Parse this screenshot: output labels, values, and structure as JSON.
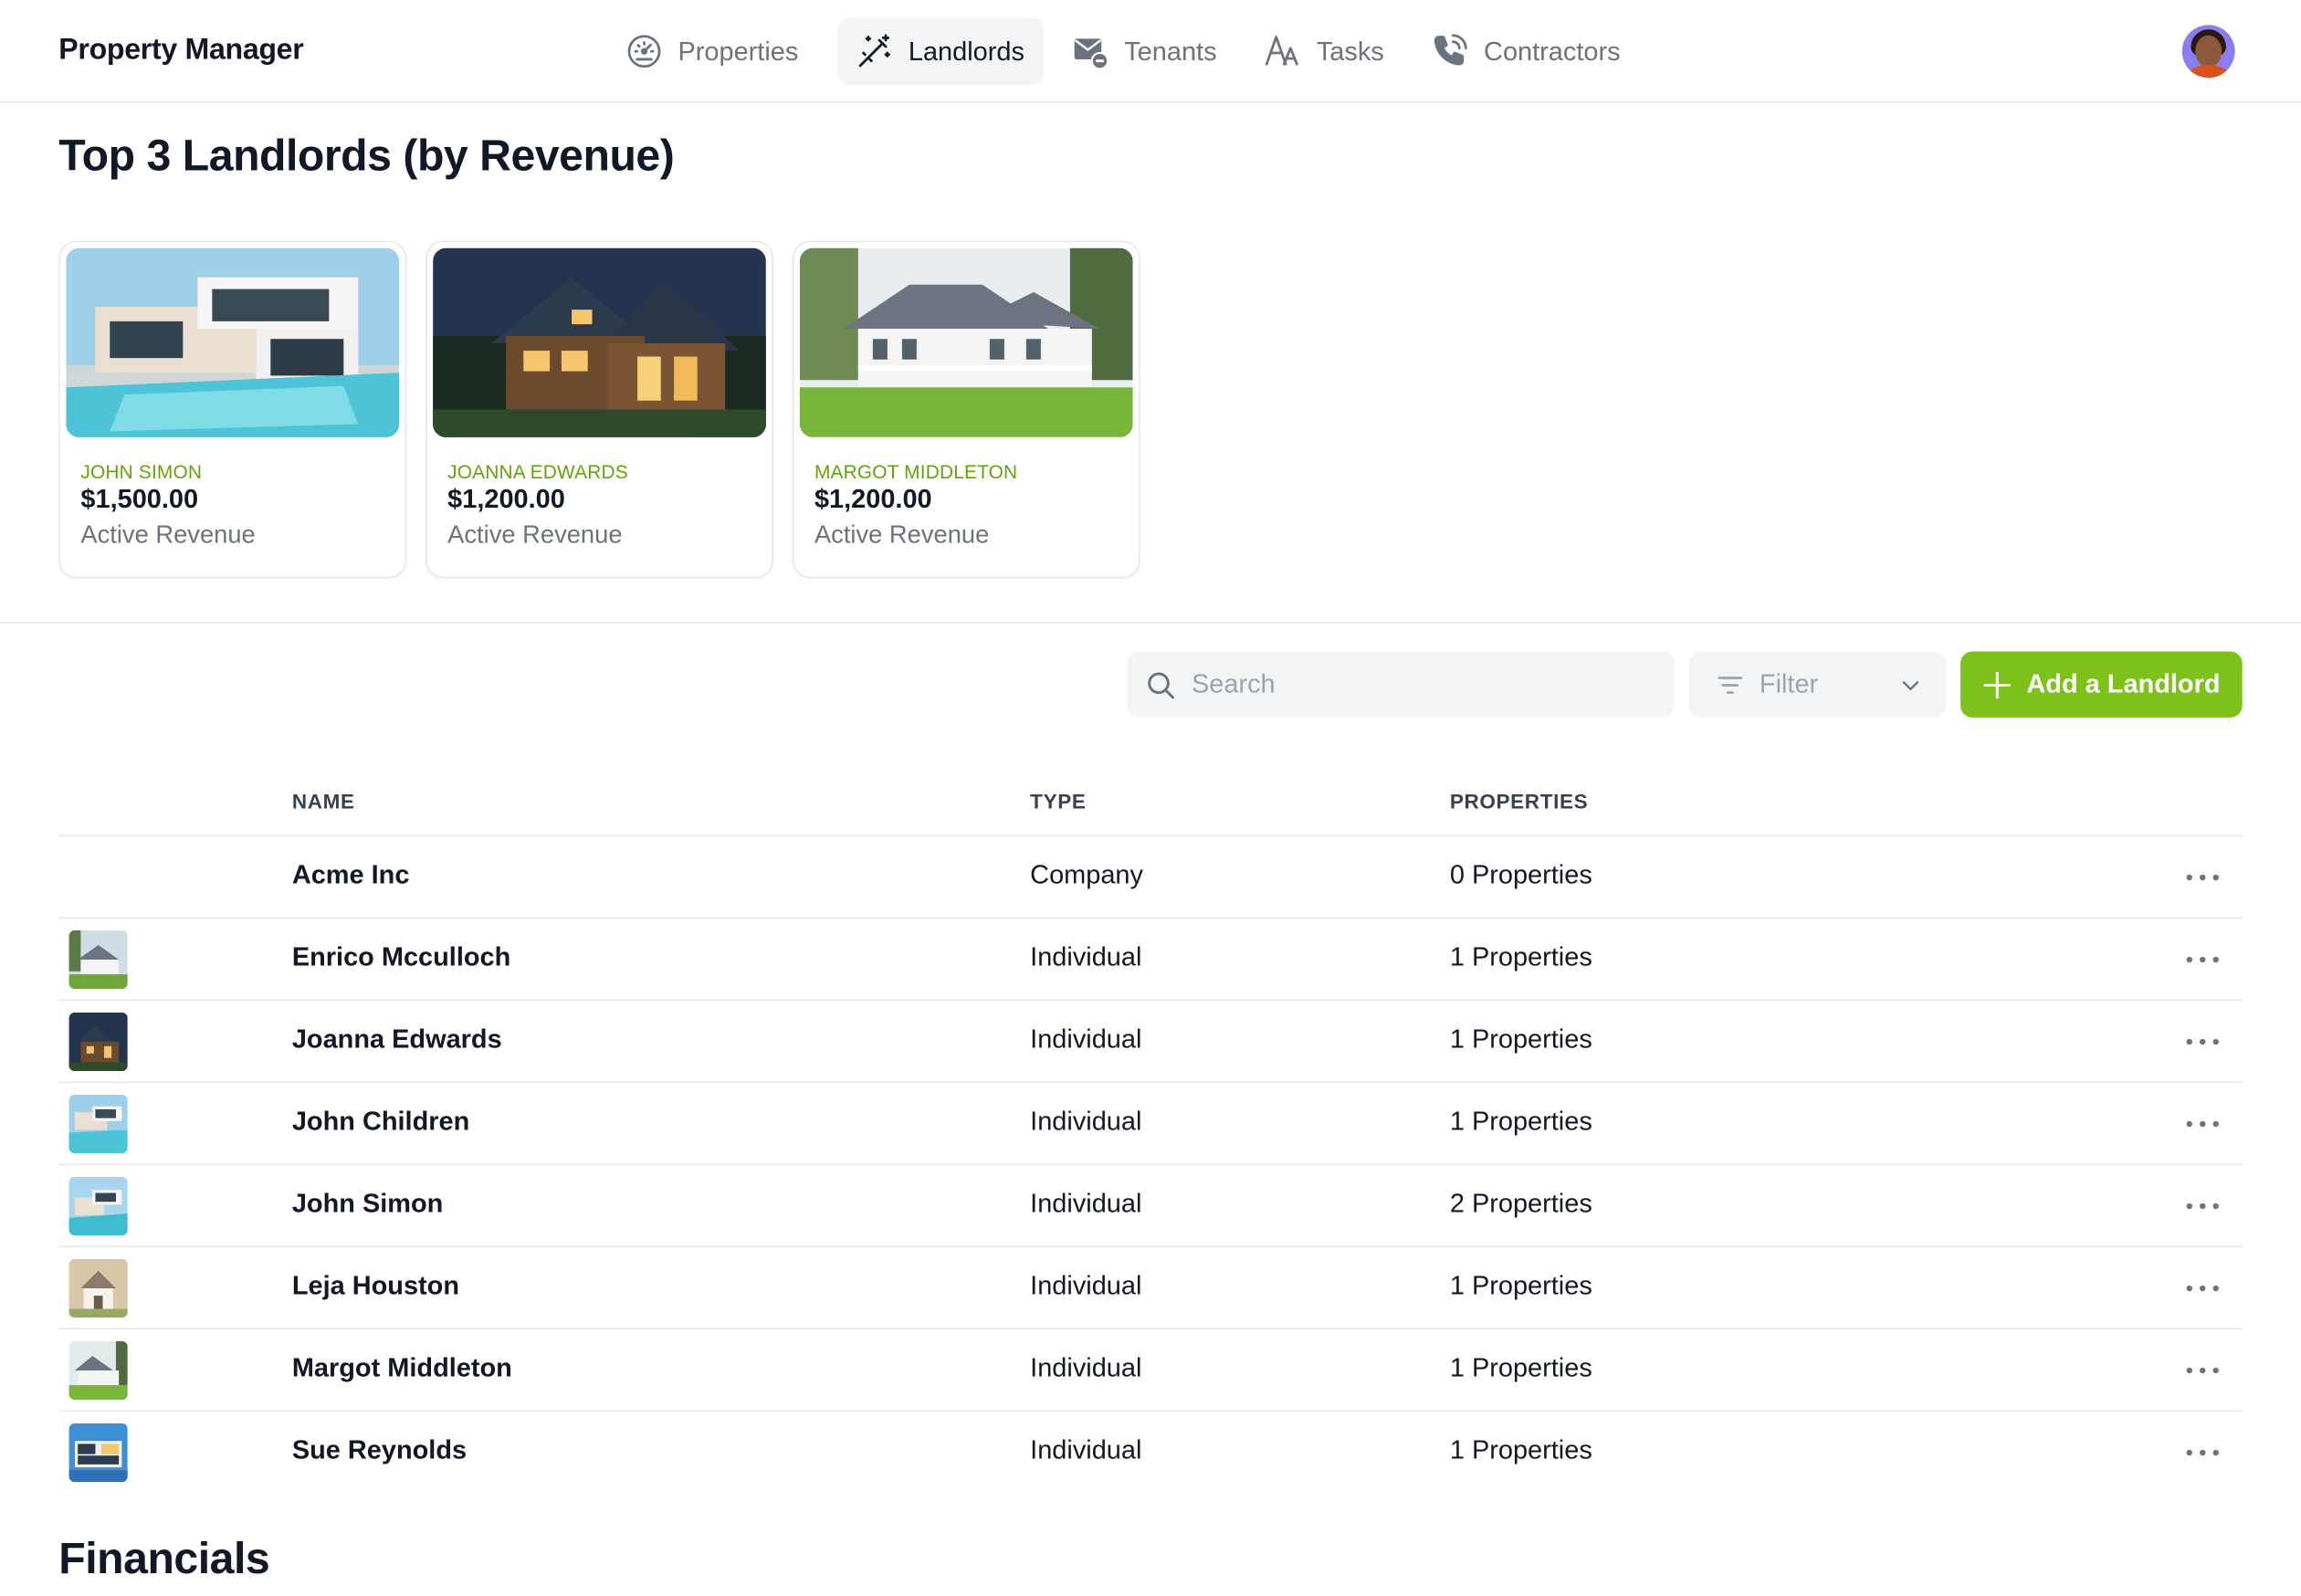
{
  "app": {
    "title": "Property Manager"
  },
  "nav": {
    "items": [
      {
        "label": "Properties",
        "icon": "speedometer-icon",
        "active": false
      },
      {
        "label": "Landlords",
        "icon": "magic-wand-icon",
        "active": true
      },
      {
        "label": "Tenants",
        "icon": "mail-minus-icon",
        "active": false
      },
      {
        "label": "Tasks",
        "icon": "font-letters-icon",
        "active": false
      },
      {
        "label": "Contractors",
        "icon": "phone-calling-icon",
        "active": false
      }
    ]
  },
  "user": {
    "avatar": "user-avatar"
  },
  "top_landlords": {
    "title": "Top 3 Landlords (by Revenue)",
    "cards": [
      {
        "name": "JOHN SIMON",
        "amount": "$1,500.00",
        "subtitle": "Active Revenue",
        "image": "modern-villa-pool"
      },
      {
        "name": "JOANNA EDWARDS",
        "amount": "$1,200.00",
        "subtitle": "Active Revenue",
        "image": "wooden-house-night"
      },
      {
        "name": "MARGOT MIDDLETON",
        "amount": "$1,200.00",
        "subtitle": "Active Revenue",
        "image": "white-colonial-house"
      }
    ]
  },
  "toolbar": {
    "search_placeholder": "Search",
    "filter_label": "Filter",
    "add_label": "Add a Landlord"
  },
  "table": {
    "columns": [
      "NAME",
      "TYPE",
      "PROPERTIES"
    ],
    "rows": [
      {
        "name": "Acme Inc",
        "type": "Company",
        "properties": "0 Properties",
        "thumb": ""
      },
      {
        "name": "Enrico Mcculloch",
        "type": "Individual",
        "properties": "1 Properties",
        "thumb": "white-colonial-house"
      },
      {
        "name": "Joanna Edwards",
        "type": "Individual",
        "properties": "1 Properties",
        "thumb": "wooden-house-night"
      },
      {
        "name": "John Children",
        "type": "Individual",
        "properties": "1 Properties",
        "thumb": "modern-villa-pool"
      },
      {
        "name": "John Simon",
        "type": "Individual",
        "properties": "2 Properties",
        "thumb": "modern-villa-pool"
      },
      {
        "name": "Leja Houston",
        "type": "Individual",
        "properties": "1 Properties",
        "thumb": "cottage-house"
      },
      {
        "name": "Margot Middleton",
        "type": "Individual",
        "properties": "1 Properties",
        "thumb": "white-colonial-house"
      },
      {
        "name": "Sue Reynolds",
        "type": "Individual",
        "properties": "1 Properties",
        "thumb": "glass-house-blue"
      }
    ]
  },
  "financials": {
    "title": "Financials"
  },
  "colors": {
    "accent": "#7cc21a",
    "accent_text": "#65a30d",
    "border": "#e5e7eb",
    "muted": "#6b7280"
  }
}
